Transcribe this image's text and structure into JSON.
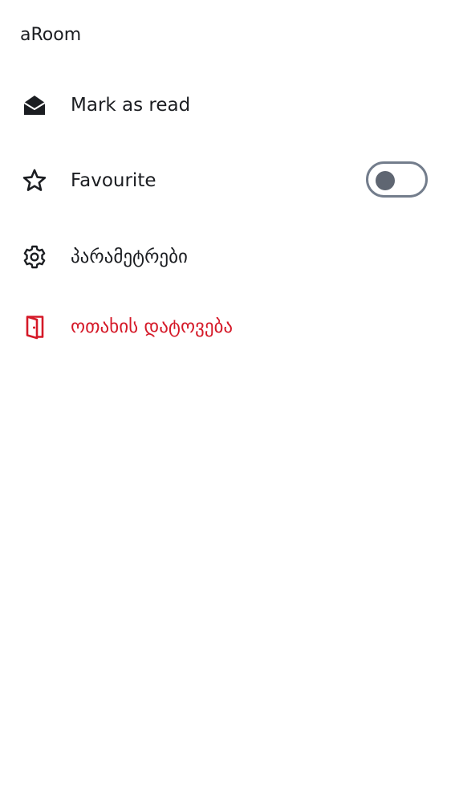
{
  "room": {
    "title": "aRoom"
  },
  "menu": {
    "mark_as_read": {
      "label": "Mark as read",
      "icon": "envelope-open-icon"
    },
    "favourite": {
      "label": "Favourite",
      "icon": "star-outline-icon",
      "toggle_on": false
    },
    "settings": {
      "label": "პარამეტრები",
      "icon": "gear-icon"
    },
    "leave_room": {
      "label": "ოთახის დატოვება",
      "icon": "door-exit-icon"
    }
  },
  "colors": {
    "text": "#1b1d21",
    "danger": "#d51928",
    "toggle_border": "#737d8c",
    "toggle_knob": "#5f6672",
    "background": "#ffffff"
  }
}
